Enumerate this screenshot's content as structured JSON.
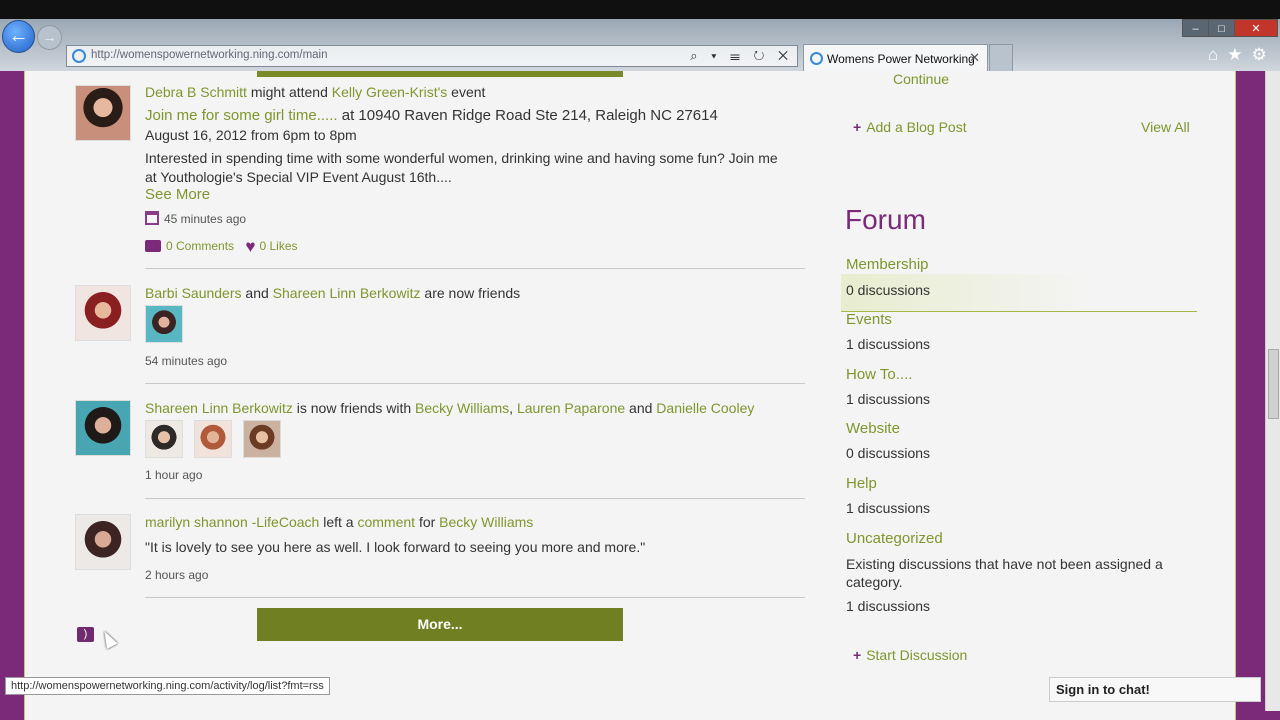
{
  "browser": {
    "url": "http://womenspowernetworking.ning.com/main",
    "tab_title": "Womens Power Networking",
    "back_icon": "back-arrow-icon",
    "forward_icon": "forward-arrow-icon",
    "min_label": "‒",
    "max_label": "□",
    "close_label": "✕",
    "tab_close": "✕",
    "addr_controls": "⌕ ▾ ☰ ↻ ✕",
    "tool_icons": "⌂★⚙"
  },
  "activity": [
    {
      "actor": "Debra B Schmitt",
      "verb": "might attend",
      "target": "Kelly Green-Krist's",
      "suffix": "event",
      "event_title": "Join me for some girl time.....",
      "event_location": "at 10940 Raven Ridge Road Ste 214, Raleigh NC 27614",
      "event_date": "August 16, 2012 from 6pm to 8pm",
      "description_line1": "Interested in spending time with some wonderful women, drinking wine and having some fun? Join me",
      "description_line2": "at Youthologie's Special VIP Event August 16th....",
      "see_more": "See More",
      "time": "45 minutes ago",
      "comments": "0 Comments",
      "likes": "0 Likes"
    },
    {
      "actor": "Barbi Saunders",
      "and": "and",
      "target": "Shareen Linn Berkowitz",
      "suffix": "are now friends",
      "time": "54 minutes ago"
    },
    {
      "actor": "Shareen Linn Berkowitz",
      "verb": "is now friends with",
      "friend1": "Becky Williams",
      "comma": ",",
      "friend2": "Lauren Paparone",
      "and": "and",
      "friend3": "Danielle Cooley",
      "time": "1 hour ago"
    },
    {
      "actor": "marilyn shannon -LifeCoach",
      "verb": "left a",
      "link": "comment",
      "for": "for",
      "target": "Becky Williams",
      "quote": "\"It is lovely to see you here as well. I look forward to seeing you more and more.\"",
      "time": "2 hours ago"
    }
  ],
  "more_button": "More...",
  "status_url": "http://womenspowernetworking.ning.com/activity/log/list?fmt=rss",
  "sidebar": {
    "continue": "Continue",
    "add_blog_post": "Add a Blog Post",
    "view_all": "View All",
    "forum_title": "Forum",
    "categories": [
      {
        "name": "Membership",
        "count": "0 discussions"
      },
      {
        "name": "Events",
        "count": "1 discussions"
      },
      {
        "name": "How To....",
        "count": "1 discussions"
      },
      {
        "name": "Website",
        "count": "0 discussions"
      },
      {
        "name": "Help",
        "count": "1 discussions"
      },
      {
        "name": "Uncategorized",
        "desc_line1": "Existing discussions that have not been assigned a",
        "desc_line2": "category.",
        "count": "1 discussions"
      }
    ],
    "start_discussion": "Start Discussion"
  },
  "chat": "Sign in to chat!",
  "plus_symbol": "+",
  "heart_symbol": "♥",
  "rss_symbol": ")"
}
